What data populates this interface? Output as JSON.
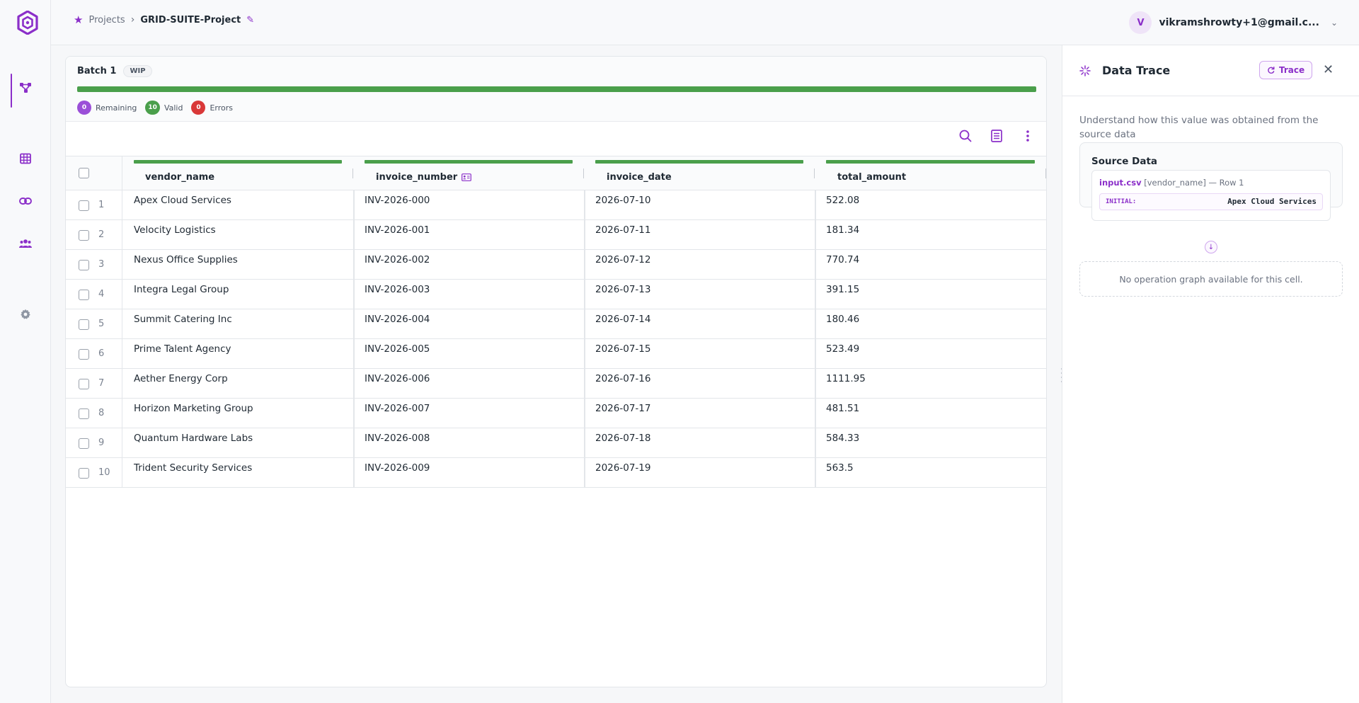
{
  "app": {
    "accent": "#8b2fc9",
    "success": "#4a9f4b",
    "error": "#d93838"
  },
  "rail": {
    "items": [
      {
        "name": "pipeline",
        "icon": "pipeline-icon",
        "active": true
      },
      {
        "name": "table",
        "icon": "table-icon",
        "active": false
      },
      {
        "name": "links",
        "icon": "link-icon",
        "active": false
      },
      {
        "name": "team",
        "icon": "users-icon",
        "active": false
      },
      {
        "name": "settings",
        "icon": "gear-icon",
        "active": false
      }
    ]
  },
  "breadcrumb": {
    "projects": "Projects",
    "project": "GRID-SUITE-Project"
  },
  "user": {
    "initial": "V",
    "email": "vikramshrowty+1@gmail.c..."
  },
  "batch": {
    "name": "Batch 1",
    "status": "WIP",
    "progress": 1.0,
    "stats": {
      "remaining_count": "0",
      "remaining_label": "Remaining",
      "valid_count": "10",
      "valid_label": "Valid",
      "errors_count": "0",
      "errors_label": "Errors"
    }
  },
  "table": {
    "columns": [
      "vendor_name",
      "invoice_number",
      "invoice_date",
      "total_amount"
    ],
    "rows": [
      [
        "1",
        "Apex Cloud Services",
        "INV-2026-000",
        "2026-07-10",
        "522.08"
      ],
      [
        "2",
        "Velocity Logistics",
        "INV-2026-001",
        "2026-07-11",
        "181.34"
      ],
      [
        "3",
        "Nexus Office Supplies",
        "INV-2026-002",
        "2026-07-12",
        "770.74"
      ],
      [
        "4",
        "Integra Legal Group",
        "INV-2026-003",
        "2026-07-13",
        "391.15"
      ],
      [
        "5",
        "Summit Catering Inc",
        "INV-2026-004",
        "2026-07-14",
        "180.46"
      ],
      [
        "6",
        "Prime Talent Agency",
        "INV-2026-005",
        "2026-07-15",
        "523.49"
      ],
      [
        "7",
        "Aether Energy Corp",
        "INV-2026-006",
        "2026-07-16",
        "1111.95"
      ],
      [
        "8",
        "Horizon Marketing Group",
        "INV-2026-007",
        "2026-07-17",
        "481.51"
      ],
      [
        "9",
        "Quantum Hardware Labs",
        "INV-2026-008",
        "2026-07-18",
        "584.33"
      ],
      [
        "10",
        "Trident Security Services",
        "INV-2026-009",
        "2026-07-19",
        "563.5"
      ]
    ]
  },
  "panel": {
    "title": "Data Trace",
    "trace_button": "Trace",
    "description": "Understand how this value was obtained from the source data",
    "source_title": "Source Data",
    "source_file": "input.csv",
    "source_ref": "[vendor_name] — Row 1",
    "initial_label": "INITIAL:",
    "initial_value": "Apex Cloud Services",
    "no_graph": "No operation graph available for this cell."
  }
}
